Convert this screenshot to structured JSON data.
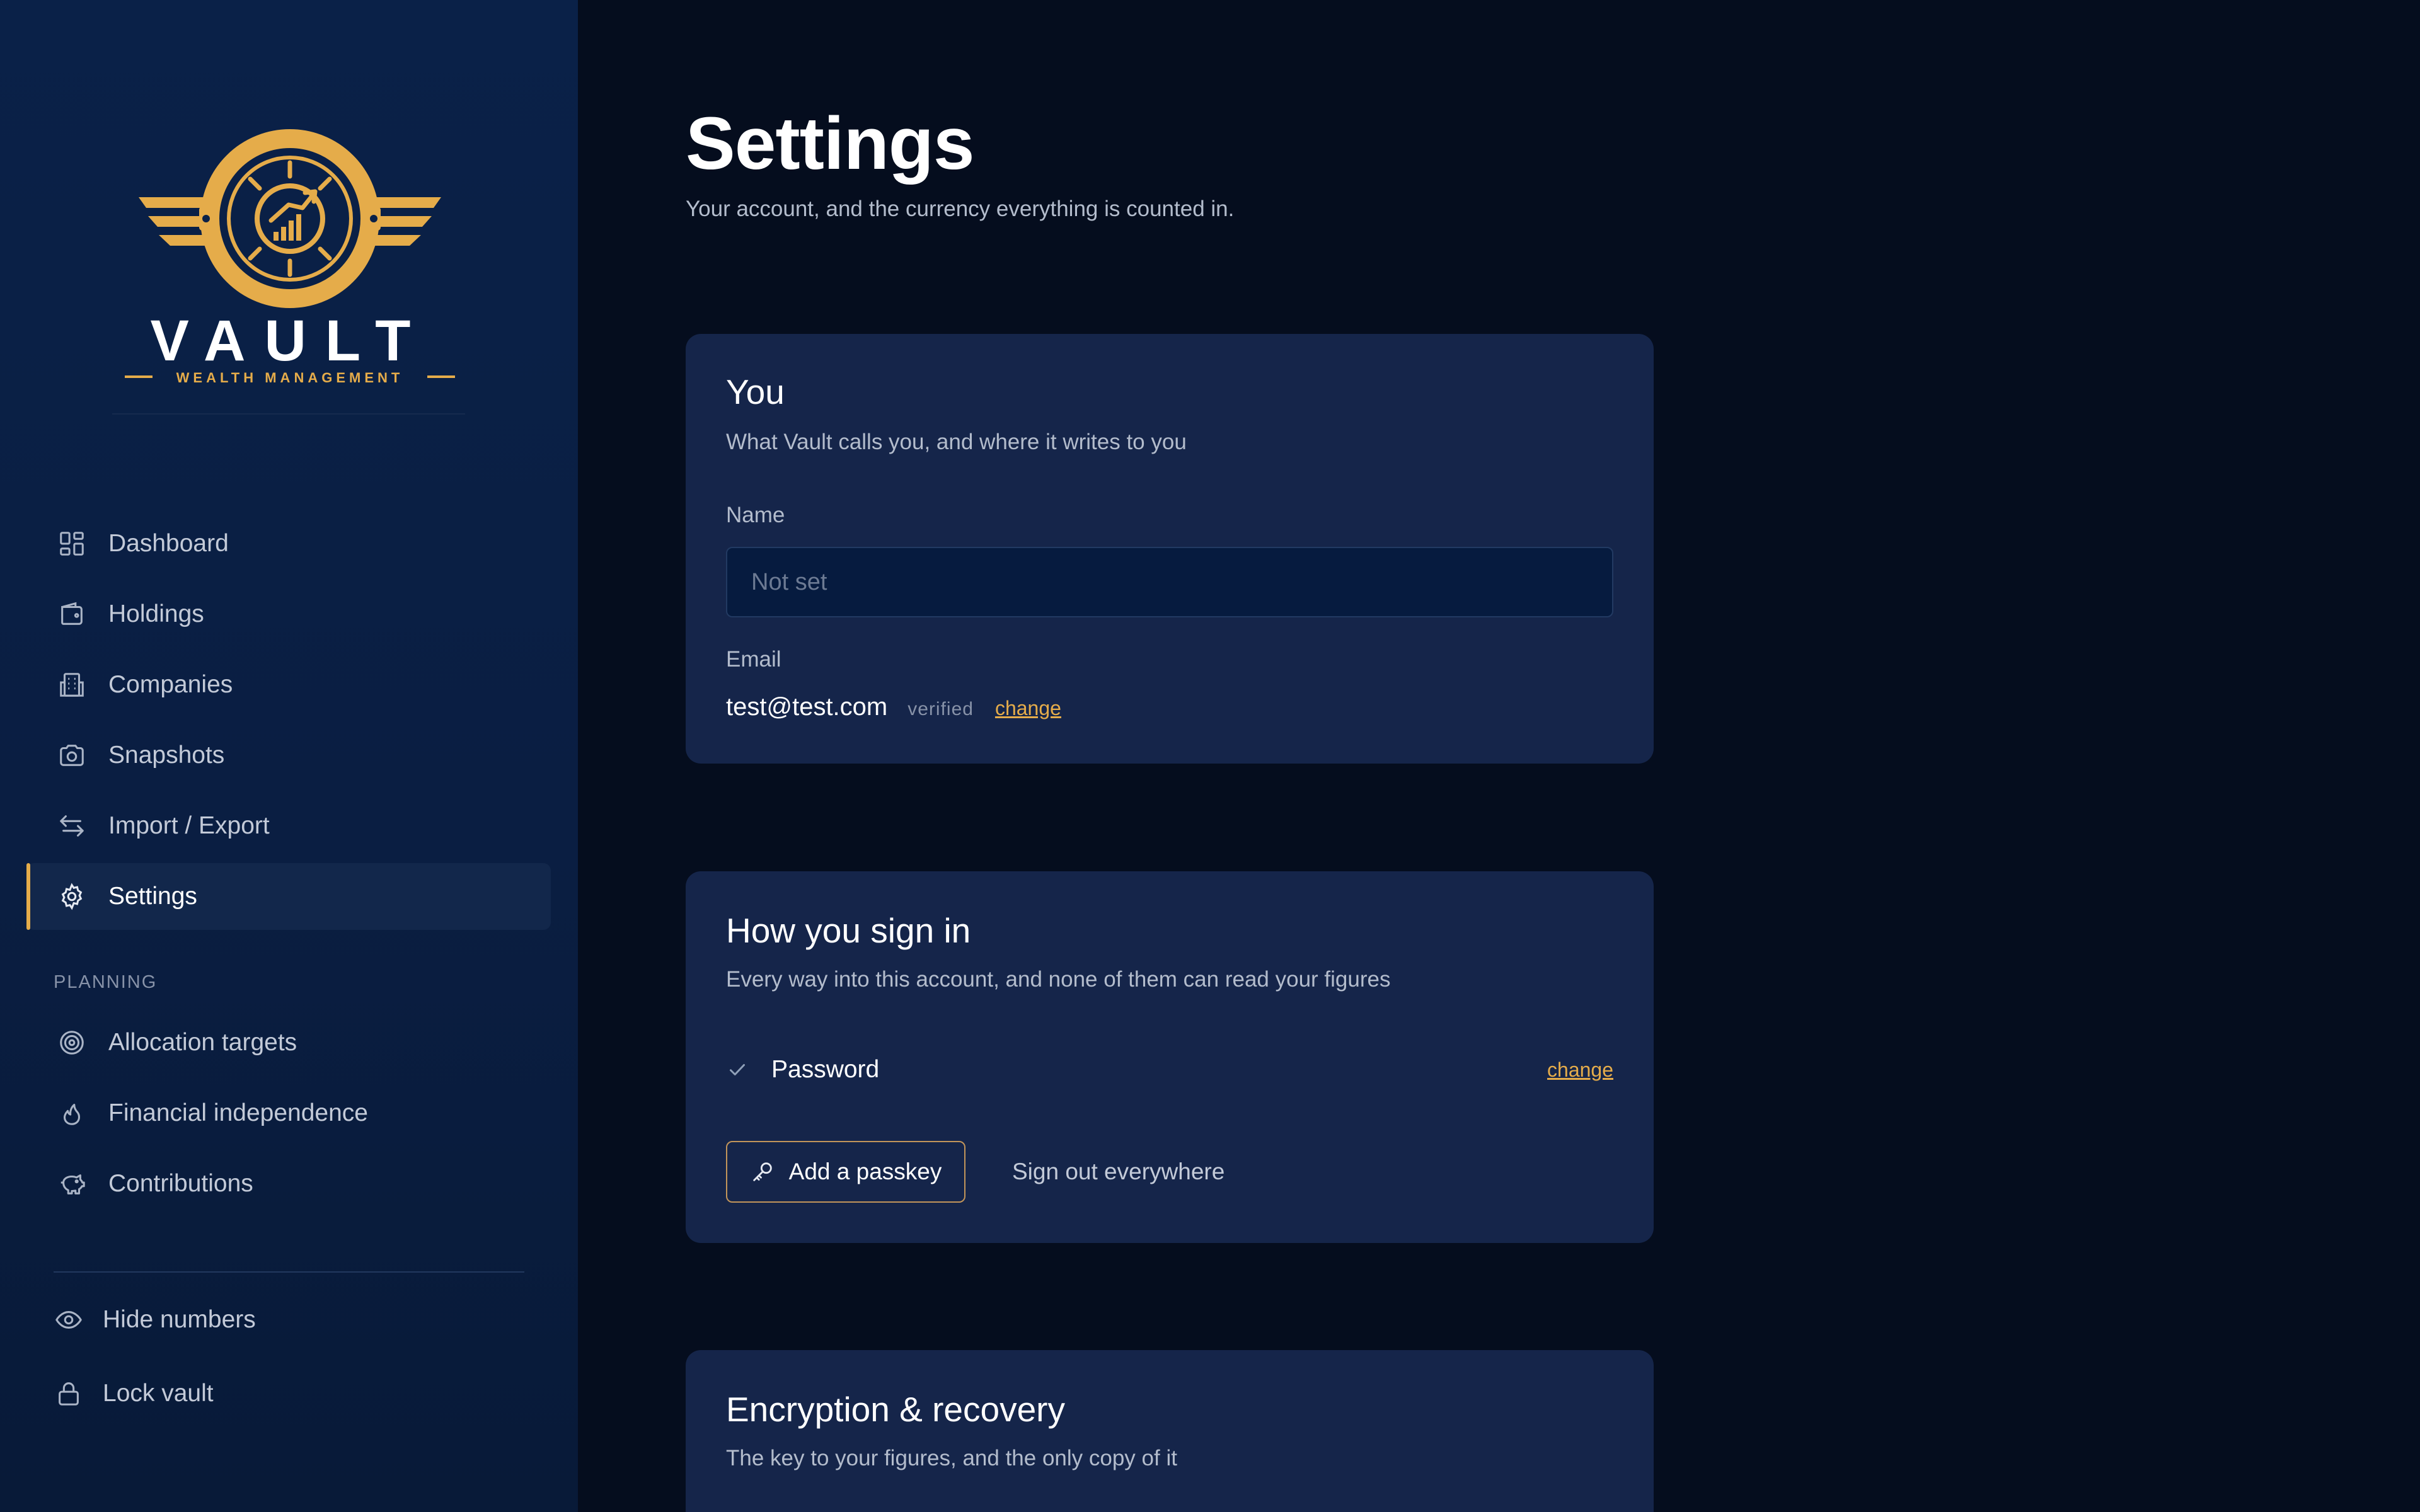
{
  "brand": {
    "logo_text": "VAULT",
    "logo_tagline": "WEALTH MANAGEMENT",
    "accent_color": "#e5ac4a"
  },
  "sidebar": {
    "items": [
      {
        "label": "Dashboard",
        "icon": "dashboard-grid-icon"
      },
      {
        "label": "Holdings",
        "icon": "wallet-icon"
      },
      {
        "label": "Companies",
        "icon": "building-icon"
      },
      {
        "label": "Snapshots",
        "icon": "camera-icon"
      },
      {
        "label": "Import / Export",
        "icon": "arrows-swap-icon"
      },
      {
        "label": "Settings",
        "icon": "gear-icon",
        "active": true
      }
    ],
    "planning_label": "PLANNING",
    "planning_items": [
      {
        "label": "Allocation targets",
        "icon": "target-icon"
      },
      {
        "label": "Financial independence",
        "icon": "flame-icon"
      },
      {
        "label": "Contributions",
        "icon": "piggy-bank-icon"
      }
    ],
    "actions": [
      {
        "label": "Hide numbers",
        "icon": "eye-icon"
      },
      {
        "label": "Lock vault",
        "icon": "lock-icon"
      }
    ]
  },
  "main": {
    "title": "Settings",
    "subtitle": "Your account, and the currency everything is counted in.",
    "you_card": {
      "title": "You",
      "subtitle": "What Vault calls you, and where it writes to you",
      "name_label": "Name",
      "name_value": "",
      "name_placeholder": "Not set",
      "email_label": "Email",
      "email_value": "test@test.com",
      "email_status": "verified",
      "email_change": "change"
    },
    "signin_card": {
      "title": "How you sign in",
      "subtitle": "Every way into this account, and none of them can read your figures",
      "password_label": "Password",
      "password_change": "change",
      "passkey_button": "Add a passkey",
      "signout_button": "Sign out everywhere"
    },
    "encryption_card": {
      "title": "Encryption & recovery",
      "subtitle": "The key to your figures, and the only copy of it"
    }
  }
}
